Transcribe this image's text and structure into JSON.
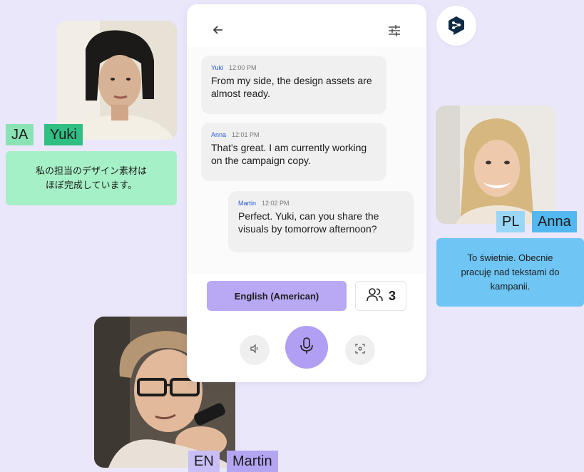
{
  "colors": {
    "background": "#ebe7fb",
    "accent_purple": "#b9a9f4",
    "ja_tag": "#8ae3b4",
    "yuki_tag": "#2fbf83",
    "ja_note": "#a6f0c7",
    "pl_tag": "#9ad7f7",
    "anna_tag": "#52b8ef",
    "pl_note": "#6fc6f5",
    "en_tag": "#c9bff6",
    "martin_tag": "#b3a5f2",
    "name_link": "#2a5ad8"
  },
  "participants": {
    "yuki": {
      "lang_code": "JA",
      "name": "Yuki",
      "translation": "私の担当のデザイン素材は\nほぼ完成しています。"
    },
    "anna": {
      "lang_code": "PL",
      "name": "Anna",
      "translation": "To świetnie. Obecnie\npracuję nad tekstami do\nkampanii."
    },
    "martin": {
      "lang_code": "EN",
      "name": "Martin"
    }
  },
  "chat": {
    "messages": [
      {
        "sender": "Yuki",
        "time": "12:00 PM",
        "text": "From my side, the design assets are almost ready."
      },
      {
        "sender": "Anna",
        "time": "12:01 PM",
        "text": "That's great. I am currently working on the campaign copy."
      },
      {
        "sender": "Martin",
        "time": "12:02 PM",
        "text": "Perfect. Yuki, can you share the visuals by tomorrow afternoon?"
      }
    ]
  },
  "controls": {
    "language": "English (American)",
    "participant_count": "3"
  },
  "icons": {
    "back": "arrow-left-icon",
    "settings": "sliders-icon",
    "people": "people-icon",
    "speaker": "speaker-icon",
    "mic": "microphone-icon",
    "scan": "scan-icon",
    "logo": "deepl-logo-icon"
  }
}
